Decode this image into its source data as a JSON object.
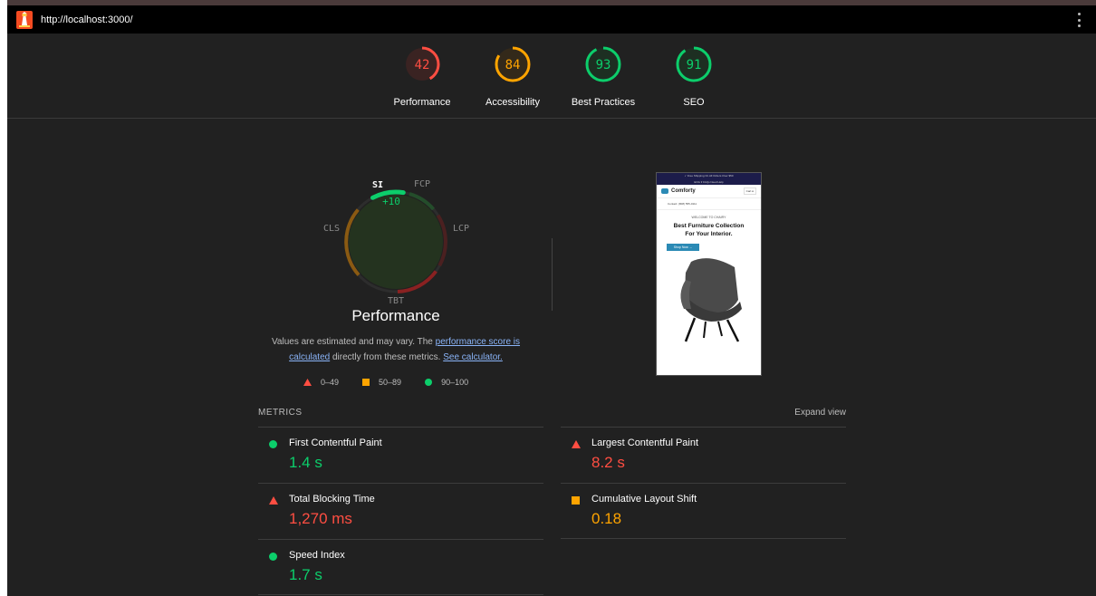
{
  "browser": {
    "url": "http://localhost:3000/"
  },
  "colors": {
    "fail": "#ff4e42",
    "average": "#ffa400",
    "pass": "#0cce6b",
    "bg": "#212121"
  },
  "gauges": [
    {
      "label": "Performance",
      "score": "42",
      "color": "#ff4e42",
      "fraction": 0.42
    },
    {
      "label": "Accessibility",
      "score": "84",
      "color": "#ffa400",
      "fraction": 0.84
    },
    {
      "label": "Best Practices",
      "score": "93",
      "color": "#0cce6b",
      "fraction": 0.93
    },
    {
      "label": "SEO",
      "score": "91",
      "color": "#0cce6b",
      "fraction": 0.91
    }
  ],
  "perf_gauge": {
    "labels": {
      "si": "SI",
      "fcp": "FCP",
      "lcp": "LCP",
      "tbt": "TBT",
      "cls": "CLS"
    },
    "highlight_delta": "+10",
    "title": "Performance"
  },
  "description": {
    "prefix": "Values are estimated and may vary. The ",
    "link1": "performance score is calculated",
    "middle": " directly from these metrics. ",
    "link2": "See calculator."
  },
  "legend": [
    {
      "shape": "triangle-icon",
      "range": "0–49",
      "color": "#ff4e42"
    },
    {
      "shape": "square-icon",
      "range": "50–89",
      "color": "#ffa400"
    },
    {
      "shape": "circle-icon",
      "range": "90–100",
      "color": "#0cce6b"
    }
  ],
  "screenshot": {
    "shipping": "✓ Free Shipping On All Orders Over $50",
    "sub": "ENG ▾   FAQs   Need Help",
    "brand": "Comforty",
    "cart": "Cart ●",
    "contact": "Contact: (808) 555-0111",
    "welcome": "WELCOME TO CHAIRY",
    "headline1": "Best Furniture Collection",
    "headline2": "For Your Interior.",
    "button": "Shop Now →"
  },
  "metrics": {
    "title": "METRICS",
    "expand": "Expand view",
    "items": [
      {
        "name": "First Contentful Paint",
        "value": "1.4 s",
        "status": "pass"
      },
      {
        "name": "Largest Contentful Paint",
        "value": "8.2 s",
        "status": "fail"
      },
      {
        "name": "Total Blocking Time",
        "value": "1,270 ms",
        "status": "fail"
      },
      {
        "name": "Cumulative Layout Shift",
        "value": "0.18",
        "status": "average"
      },
      {
        "name": "Speed Index",
        "value": "1.7 s",
        "status": "pass"
      }
    ]
  }
}
